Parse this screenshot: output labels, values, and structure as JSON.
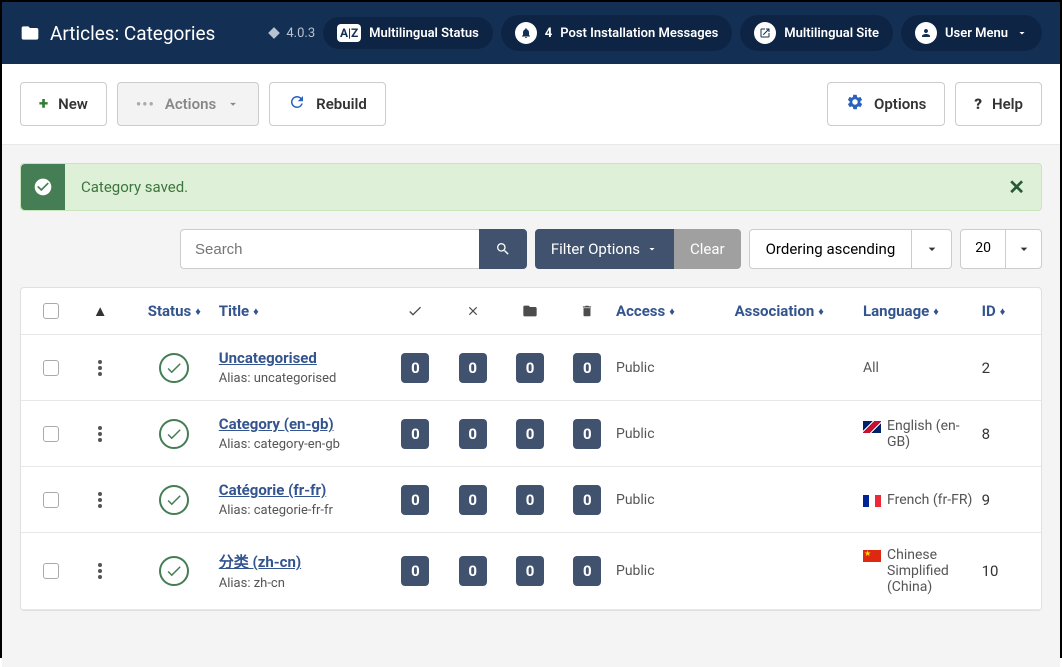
{
  "header": {
    "title": "Articles: Categories",
    "version": "4.0.3",
    "multilingual_status": "Multilingual Status",
    "post_install_count": "4",
    "post_install_label": "Post Installation Messages",
    "multilingual_site": "Multilingual Site",
    "user_menu": "User Menu"
  },
  "toolbar": {
    "new": "New",
    "actions": "Actions",
    "rebuild": "Rebuild",
    "options": "Options",
    "help": "Help"
  },
  "alert": {
    "message": "Category saved."
  },
  "filters": {
    "search_placeholder": "Search",
    "filter_options": "Filter Options",
    "clear": "Clear",
    "ordering": "Ordering ascending",
    "limit": "20"
  },
  "columns": {
    "status": "Status",
    "title": "Title",
    "access": "Access",
    "association": "Association",
    "language": "Language",
    "id": "ID"
  },
  "rows": [
    {
      "title": "Uncategorised",
      "alias": "Alias: uncategorised",
      "c1": "0",
      "c2": "0",
      "c3": "0",
      "c4": "0",
      "access": "Public",
      "language": "All",
      "flag": "",
      "id": "2"
    },
    {
      "title": "Category (en-gb)",
      "alias": "Alias: category-en-gb",
      "c1": "0",
      "c2": "0",
      "c3": "0",
      "c4": "0",
      "access": "Public",
      "language": "English (en-GB)",
      "flag": "gb",
      "id": "8"
    },
    {
      "title": "Catégorie (fr-fr)",
      "alias": "Alias: categorie-fr-fr",
      "c1": "0",
      "c2": "0",
      "c3": "0",
      "c4": "0",
      "access": "Public",
      "language": "French (fr-FR)",
      "flag": "fr",
      "id": "9"
    },
    {
      "title": "分类 (zh-cn)",
      "alias": "Alias: zh-cn",
      "c1": "0",
      "c2": "0",
      "c3": "0",
      "c4": "0",
      "access": "Public",
      "language": "Chinese Simplified (China)",
      "flag": "cn",
      "id": "10"
    }
  ]
}
